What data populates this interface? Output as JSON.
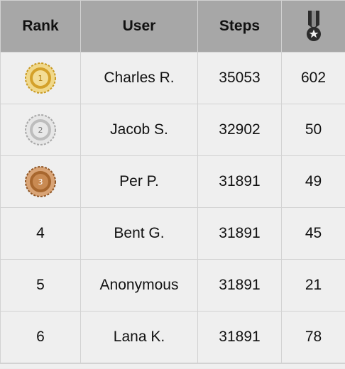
{
  "header": {
    "rank": "Rank",
    "user": "User",
    "steps": "Steps",
    "medals_icon": "military-medal-icon"
  },
  "colors": {
    "header_bg": "#a7a7a7",
    "row_bg": "#efefef",
    "gold": "#d4a12a",
    "silver": "#bdbdbd",
    "bronze": "#a8672e"
  },
  "rows": [
    {
      "rank": "1",
      "medal_icon": "gold-medal-icon",
      "user": "Charles R.",
      "steps": "35053",
      "medals": "602"
    },
    {
      "rank": "2",
      "medal_icon": "silver-medal-icon",
      "user": "Jacob S.",
      "steps": "32902",
      "medals": "50"
    },
    {
      "rank": "3",
      "medal_icon": "bronze-medal-icon",
      "user": "Per P.",
      "steps": "31891",
      "medals": "49"
    },
    {
      "rank": "4",
      "user": "Bent G.",
      "steps": "31891",
      "medals": "45"
    },
    {
      "rank": "5",
      "user": "Anonymous",
      "steps": "31891",
      "medals": "21"
    },
    {
      "rank": "6",
      "user": "Lana K.",
      "steps": "31891",
      "medals": "78"
    }
  ]
}
